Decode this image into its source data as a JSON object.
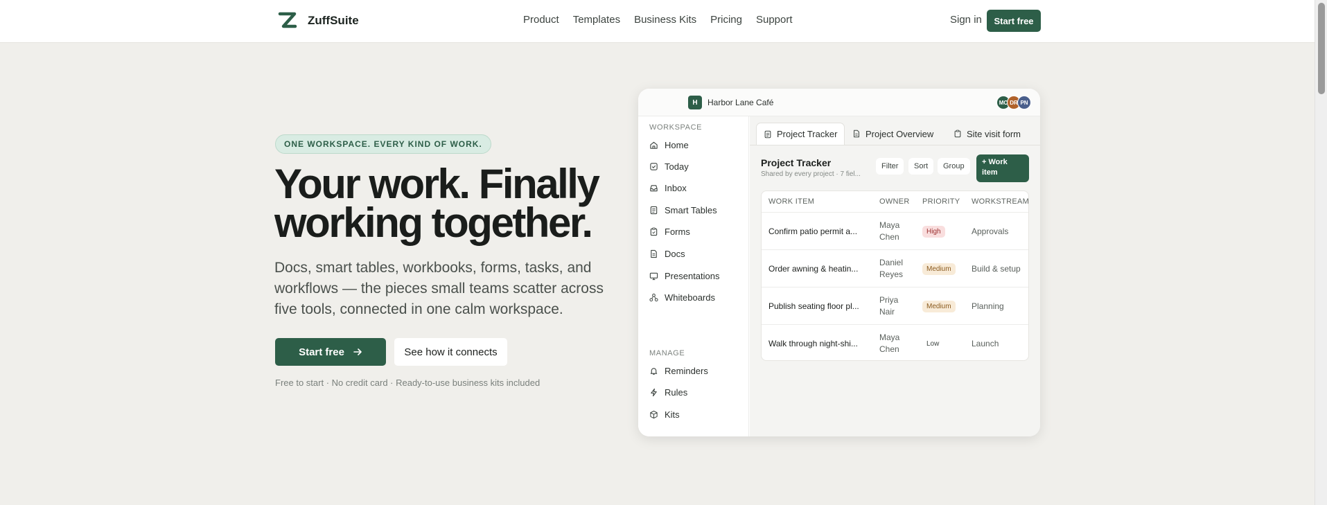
{
  "colors": {
    "brand": "#2d5e48",
    "priority_high": "#f9dede",
    "priority_medium": "#f8ebd8",
    "priority_low": "#ffffff"
  },
  "nav": {
    "brand_name": "ZuffSuite",
    "logo_icon": "z-logo-icon",
    "links": [
      "Product",
      "Templates",
      "Business Kits",
      "Pricing",
      "Support"
    ],
    "sign_in": "Sign in",
    "cta": "Start free"
  },
  "hero": {
    "eyebrow": "ONE WORKSPACE. EVERY KIND OF WORK.",
    "title": "Your work. Finally working together.",
    "subtitle": "Docs, smart tables, workbooks, forms, tasks, and workflows — the pieces small teams scatter across five tools, connected in one calm workspace.",
    "primary_button": "Start free",
    "primary_icon": "arrow-right-icon",
    "secondary_button": "See how it connects",
    "note": "Free to start · No credit card · Ready-to-use business kits included"
  },
  "app": {
    "workspace_initial": "H",
    "workspace_name": "Harbor Lane Café",
    "avatars": [
      {
        "initials": "MC",
        "color": "#2d5e48"
      },
      {
        "initials": "DR",
        "color": "#b0622a"
      },
      {
        "initials": "PN",
        "color": "#4a5f8c"
      }
    ],
    "sidebar": {
      "workspace_heading": "WORKSPACE",
      "workspace_items": [
        {
          "label": "Home",
          "icon": "home-icon"
        },
        {
          "label": "Today",
          "icon": "calendar-check-icon"
        },
        {
          "label": "Inbox",
          "icon": "inbox-icon"
        },
        {
          "label": "Smart Tables",
          "icon": "table-icon"
        },
        {
          "label": "Forms",
          "icon": "clipboard-icon"
        },
        {
          "label": "Docs",
          "icon": "document-icon"
        },
        {
          "label": "Presentations",
          "icon": "presentation-icon"
        },
        {
          "label": "Whiteboards",
          "icon": "whiteboard-icon"
        }
      ],
      "manage_heading": "MANAGE",
      "manage_items": [
        {
          "label": "Reminders",
          "icon": "bell-icon"
        },
        {
          "label": "Rules",
          "icon": "zap-icon"
        },
        {
          "label": "Kits",
          "icon": "box-icon"
        }
      ]
    },
    "tabs": [
      {
        "label": "Project Tracker",
        "icon": "table-icon",
        "active": true
      },
      {
        "label": "Project Overview",
        "icon": "document-icon",
        "active": false
      },
      {
        "label": "Site visit form",
        "icon": "clipboard-icon",
        "active": false
      }
    ],
    "table": {
      "title": "Project Tracker",
      "subtitle": "Shared by every project · 7 fiel...",
      "filter": "Filter",
      "sort": "Sort",
      "group": "Group",
      "add": "+ Work item",
      "columns": [
        "WORK ITEM",
        "OWNER",
        "PRIORITY",
        "WORKSTREAM"
      ],
      "rows": [
        {
          "work": "Confirm patio permit a...",
          "owner": "Maya Chen",
          "priority": "High",
          "stream": "Approvals"
        },
        {
          "work": "Order awning & heatin...",
          "owner": "Daniel Reyes",
          "priority": "Medium",
          "stream": "Build & setup"
        },
        {
          "work": "Publish seating floor pl...",
          "owner": "Priya Nair",
          "priority": "Medium",
          "stream": "Planning"
        },
        {
          "work": "Walk through night-shi...",
          "owner": "Maya Chen",
          "priority": "Low",
          "stream": "Launch"
        }
      ]
    }
  }
}
